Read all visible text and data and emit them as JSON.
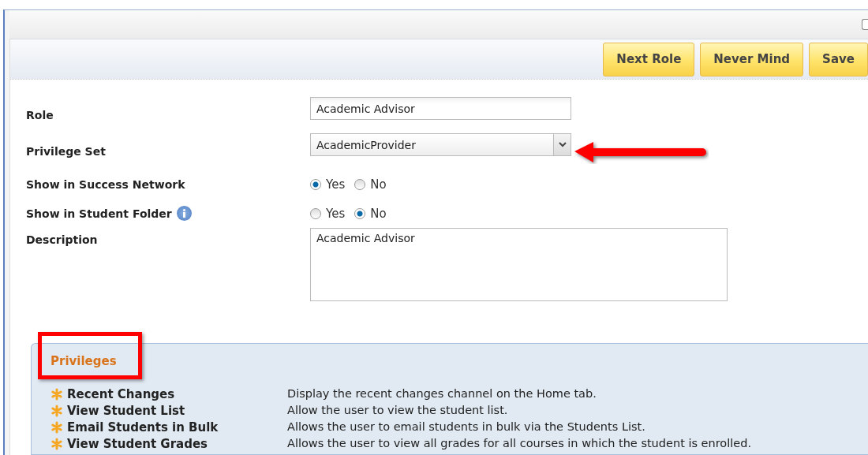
{
  "toolbar": {
    "buttons": [
      "Next Role",
      "Never Mind",
      "Save"
    ]
  },
  "form": {
    "fields": [
      {
        "kind": "text",
        "label": "Role",
        "value": "Academic Advisor"
      },
      {
        "kind": "select",
        "label": "Privilege Set",
        "value": "AcademicProvider"
      },
      {
        "kind": "radio",
        "label": "Show in Success Network",
        "info": false,
        "options": [
          {
            "label": "Yes",
            "selected": true
          },
          {
            "label": "No",
            "selected": false
          }
        ]
      },
      {
        "kind": "radio",
        "label": "Show in Student Folder",
        "info": true,
        "options": [
          {
            "label": "Yes",
            "selected": false
          },
          {
            "label": "No",
            "selected": true
          }
        ]
      },
      {
        "kind": "textarea",
        "label": "Description",
        "value": "Academic Advisor"
      }
    ]
  },
  "privileges": {
    "title": "Privileges",
    "items": [
      {
        "name": "Recent Changes",
        "description": "Display the recent changes channel on the Home tab."
      },
      {
        "name": "View Student List",
        "description": "Allow the user to view the student list."
      },
      {
        "name": "Email Students in Bulk",
        "description": "Allows the user to email students in bulk via the Students List."
      },
      {
        "name": "View Student Grades",
        "description": "Allows the user to view all grades for all courses in which the student is enrolled."
      }
    ]
  }
}
